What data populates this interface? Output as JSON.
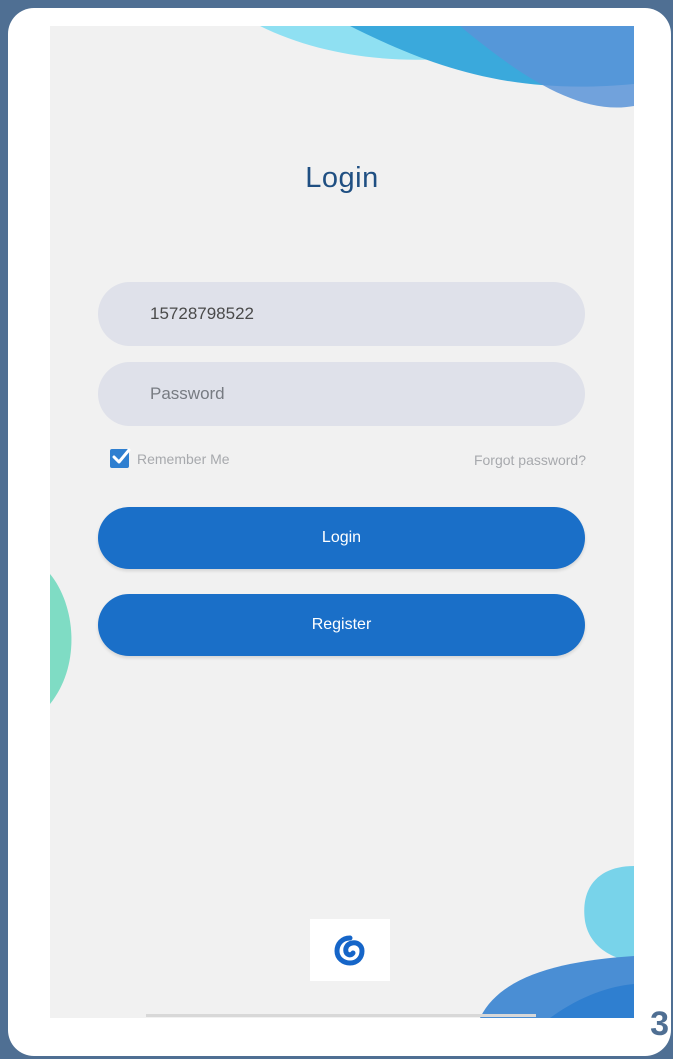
{
  "screen": {
    "title": "Login"
  },
  "form": {
    "username_value": "15728798522",
    "password_placeholder": "Password",
    "remember_label": "Remember Me",
    "remember_checked": true,
    "forgot_label": "Forgot password?"
  },
  "buttons": {
    "login_label": "Login",
    "register_label": "Register"
  },
  "slide": {
    "number": "3"
  },
  "icons": {
    "logo": "swirl-logo-icon",
    "checkbox": "checkmark-icon"
  },
  "colors": {
    "frame": "#4f6f93",
    "screen_bg": "#f1f1f1",
    "title": "#1f4f82",
    "field_bg": "#dfe1ea",
    "button": "#1a6fc8",
    "accent_blue": "#2f7fd0",
    "accent_cyan": "#78d3ea",
    "accent_teal": "#7fdcc4"
  }
}
